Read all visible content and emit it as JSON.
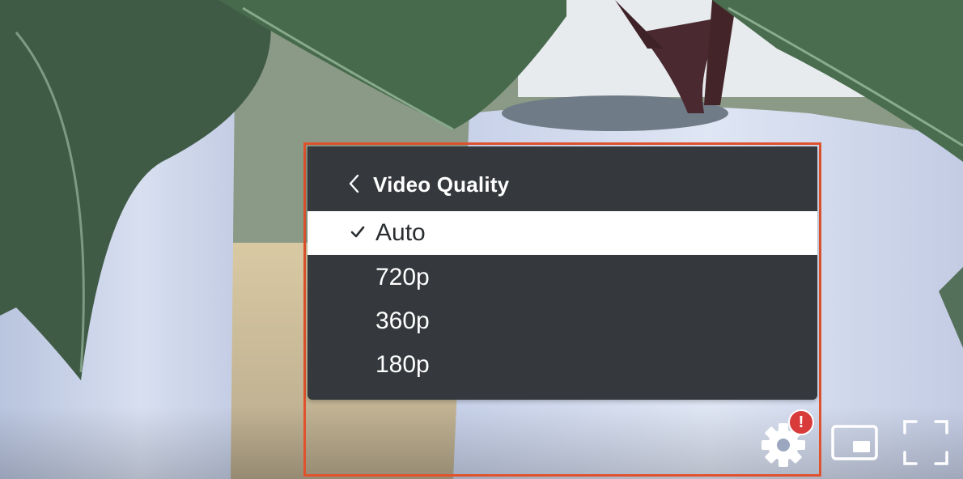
{
  "menu": {
    "title": "Video Quality",
    "back_icon": "chevron-left-icon",
    "options": [
      {
        "label": "Auto",
        "selected": true
      },
      {
        "label": "720p",
        "selected": false
      },
      {
        "label": "360p",
        "selected": false
      },
      {
        "label": "180p",
        "selected": false
      }
    ]
  },
  "controls": {
    "settings_icon": "gear-icon",
    "settings_badge": "!",
    "pip_icon": "picture-in-picture-icon",
    "fullscreen_icon": "fullscreen-icon"
  },
  "colors": {
    "menu_bg": "#35383c",
    "selected_bg": "#ffffff",
    "highlight_border": "#e0522d",
    "badge": "#d93a3a"
  }
}
